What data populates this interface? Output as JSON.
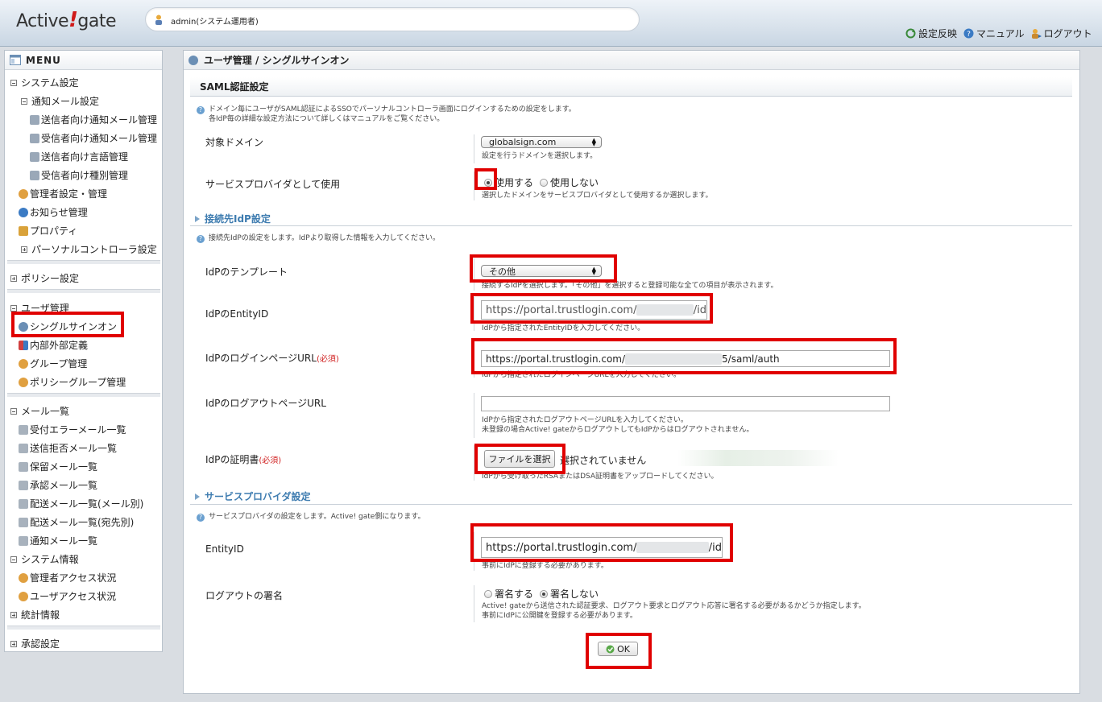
{
  "header": {
    "logo_text_1": "Active",
    "logo_bang": "!",
    "logo_text_2": "gate",
    "user": "admin(システム運用者)",
    "toolbar": {
      "apply": "設定反映",
      "manual": "マニュアル",
      "logout": "ログアウト"
    }
  },
  "sidebar": {
    "title": "MENU",
    "items": {
      "system_settings": "システム設定",
      "notify_mail_settings": "通知メール設定",
      "sender_notify": "送信者向け通知メール管理",
      "recipient_notify": "受信者向け通知メール管理",
      "sender_lang": "送信者向け言語管理",
      "recipient_type": "受信者向け種別管理",
      "admin_settings": "管理者設定・管理",
      "notice": "お知らせ管理",
      "property": "プロパティ",
      "personal_ctrl": "パーソナルコントローラ設定",
      "policy_settings": "ポリシー設定",
      "user_mgmt": "ユーザ管理",
      "sso": "シングルサインオン",
      "inout_def": "内部外部定義",
      "group_mgmt": "グループ管理",
      "policy_group": "ポリシーグループ管理",
      "mail_list": "メール一覧",
      "recv_error": "受付エラーメール一覧",
      "send_reject": "送信拒否メール一覧",
      "hold_mail": "保留メール一覧",
      "approve_mail": "承認メール一覧",
      "delivery_mail": "配送メール一覧(メール別)",
      "delivery_dest": "配送メール一覧(宛先別)",
      "notify_mail": "通知メール一覧",
      "system_info": "システム情報",
      "admin_access": "管理者アクセス状況",
      "user_access": "ユーザアクセス状況",
      "stats": "統計情報",
      "approval_settings": "承認設定"
    }
  },
  "main": {
    "title": "ユーザ管理 / シングルサインオン",
    "saml_section": "SAML認証設定",
    "saml_info_1": "ドメイン毎にユーザがSAML認証によるSSOでパーソナルコントローラ画面にログインするための設定をします。",
    "saml_info_2": "各IdP毎の詳細な設定方法について詳しくはマニュアルをご覧ください。",
    "domain_label": "対象ドメイン",
    "domain_value": "globalsign.com",
    "domain_help": "設定を行うドメインを選択します。",
    "sp_use_label": "サービスプロバイダとして使用",
    "sp_use_yes": "使用する",
    "sp_use_no": "使用しない",
    "sp_use_help": "選択したドメインをサービスプロバイダとして使用するか選択します。",
    "idp_section": "接続先IdP設定",
    "idp_info": "接続先IdPの設定をします。IdPより取得した情報を入力してください。",
    "template_label": "IdPのテンプレート",
    "template_value": "その他",
    "template_help": "接続するIdPを選択します。「その他」を選択すると登録可能な全ての項目が表示されます。",
    "entityid_label": "IdPのEntityID",
    "entityid_value_pre": "https://portal.trustlogin.com/",
    "entityid_value_post": "/id",
    "entityid_help": "IdPから指定されたEntityIDを入力してください。",
    "login_label": "IdPのログインページURL",
    "required": "(必須)",
    "login_value_pre": "https://portal.trustlogin.com/",
    "login_value_post": "5/saml/auth",
    "login_help": "IdPから指定されたログインページURLを入力してください。",
    "logout_label": "IdPのログアウトページURL",
    "logout_value": "",
    "logout_help_1": "IdPから指定されたログアウトページURLを入力してください。",
    "logout_help_2": "未登録の場合Active! gateからログアウトしてもIdPからはログアウトされません。",
    "cert_label": "IdPの証明書",
    "cert_button": "ファイルを選択",
    "cert_status": "選択されていません",
    "cert_help": "IdPから受け取ったRSAまたはDSA証明書をアップロードしてください。",
    "sp_section": "サービスプロバイダ設定",
    "sp_info": "サービスプロバイダの設定をします。Active! gate側になります。",
    "sp_entityid_label": "EntityID",
    "sp_entityid_pre": "https://portal.trustlogin.com/",
    "sp_entityid_post": "/id",
    "sp_entityid_help": "事前にIdPに登録する必要があります。",
    "sign_label": "ログアウトの署名",
    "sign_yes": "署名する",
    "sign_no": "署名しない",
    "sign_help_1": "Active! gateから送信された認証要求、ログアウト要求とログアウト応答に署名する必要があるかどうか指定します。",
    "sign_help_2": "事前にIdPに公開鍵を登録する必要があります。",
    "ok_button": "OK"
  },
  "colors": {
    "highlight": "#e00000",
    "link_blue": "#3e7cb0",
    "required": "#d02020"
  }
}
